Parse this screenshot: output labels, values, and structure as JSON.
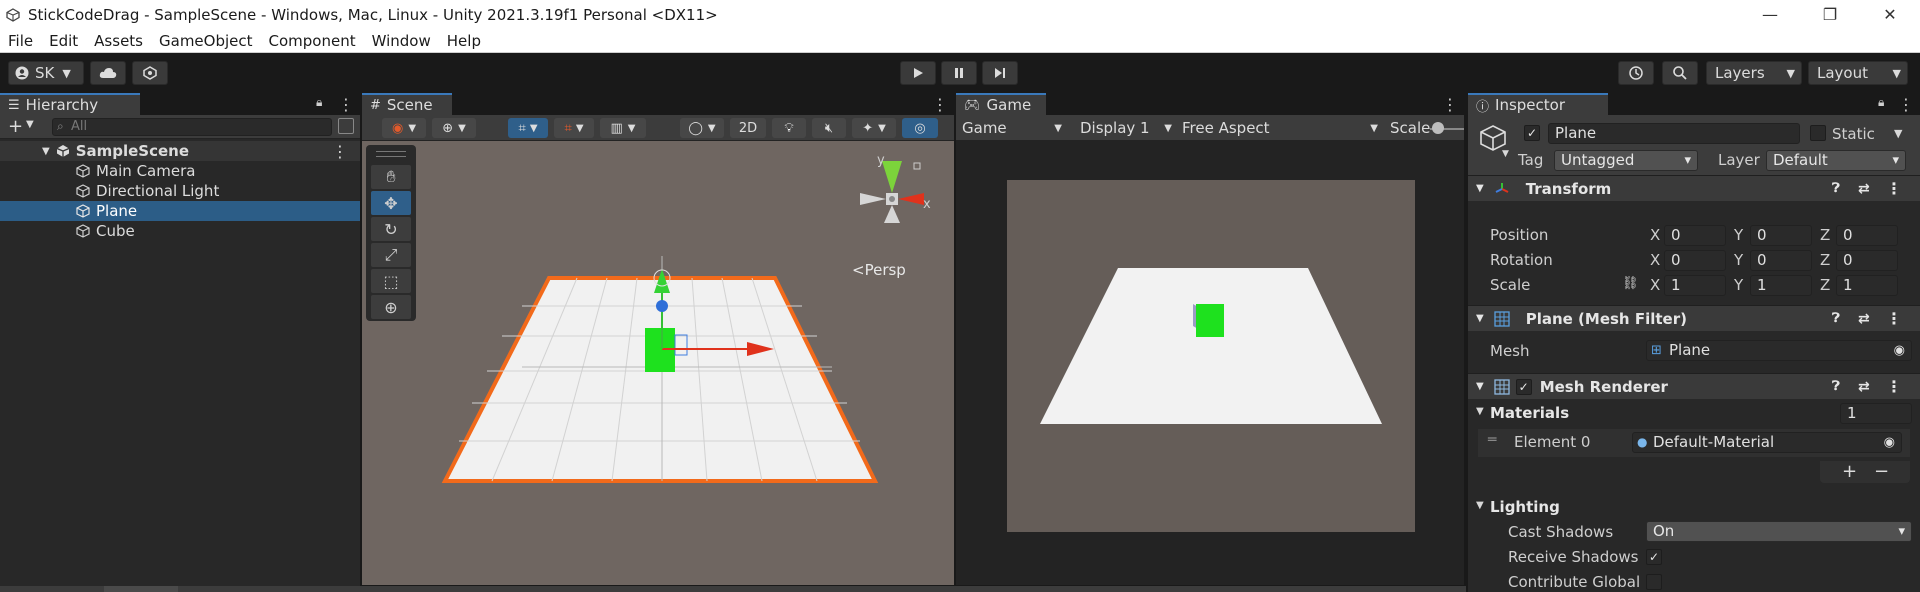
{
  "window": {
    "title": "StickCodeDrag - SampleScene - Windows, Mac, Linux - Unity 2021.3.19f1 Personal <DX11>",
    "minimize": "—",
    "restore": "❐",
    "close": "✕"
  },
  "menu": [
    "File",
    "Edit",
    "Assets",
    "GameObject",
    "Component",
    "Window",
    "Help"
  ],
  "toolbar": {
    "account": "SK",
    "layers": "Layers",
    "layout": "Layout"
  },
  "hierarchy": {
    "tab": "Hierarchy",
    "search_placeholder": "All",
    "scene": "SampleScene",
    "items": [
      "Main Camera",
      "Directional Light",
      "Plane",
      "Cube"
    ]
  },
  "scene": {
    "tab": "Scene",
    "btn_2d": "2D",
    "persp": "Persp",
    "gizmo_y": "y",
    "gizmo_x": "x"
  },
  "game": {
    "tab": "Game",
    "mode": "Game",
    "display": "Display 1",
    "aspect": "Free Aspect",
    "scale": "Scale"
  },
  "inspector": {
    "tab": "Inspector",
    "object_name": "Plane",
    "static_label": "Static",
    "tag_label": "Tag",
    "tag_value": "Untagged",
    "layer_label": "Layer",
    "layer_value": "Default",
    "transform": {
      "title": "Transform",
      "position_label": "Position",
      "rotation_label": "Rotation",
      "scale_label": "Scale",
      "position": {
        "x": "0",
        "y": "0",
        "z": "0"
      },
      "rotation": {
        "x": "0",
        "y": "0",
        "z": "0"
      },
      "scale": {
        "x": "1",
        "y": "1",
        "z": "1"
      },
      "axis_x": "X",
      "axis_y": "Y",
      "axis_z": "Z"
    },
    "mesh_filter": {
      "title": "Plane (Mesh Filter)",
      "mesh_label": "Mesh",
      "mesh_value": "Plane"
    },
    "mesh_renderer": {
      "title": "Mesh Renderer",
      "materials_label": "Materials",
      "materials_count": "1",
      "element_label": "Element 0",
      "element_value": "Default-Material",
      "add": "+",
      "remove": "−",
      "lighting_label": "Lighting",
      "cast_shadows_label": "Cast Shadows",
      "cast_shadows_value": "On",
      "receive_shadows_label": "Receive Shadows",
      "contribute_gi_label": "Contribute Global I"
    }
  },
  "colors": {
    "accent": "#3a79bb",
    "selection": "#2c5d87",
    "plane_outline": "#f26a1b",
    "cube": "#1ee11e",
    "scene_bg": "#6f6661",
    "game_bg": "#655d58"
  }
}
